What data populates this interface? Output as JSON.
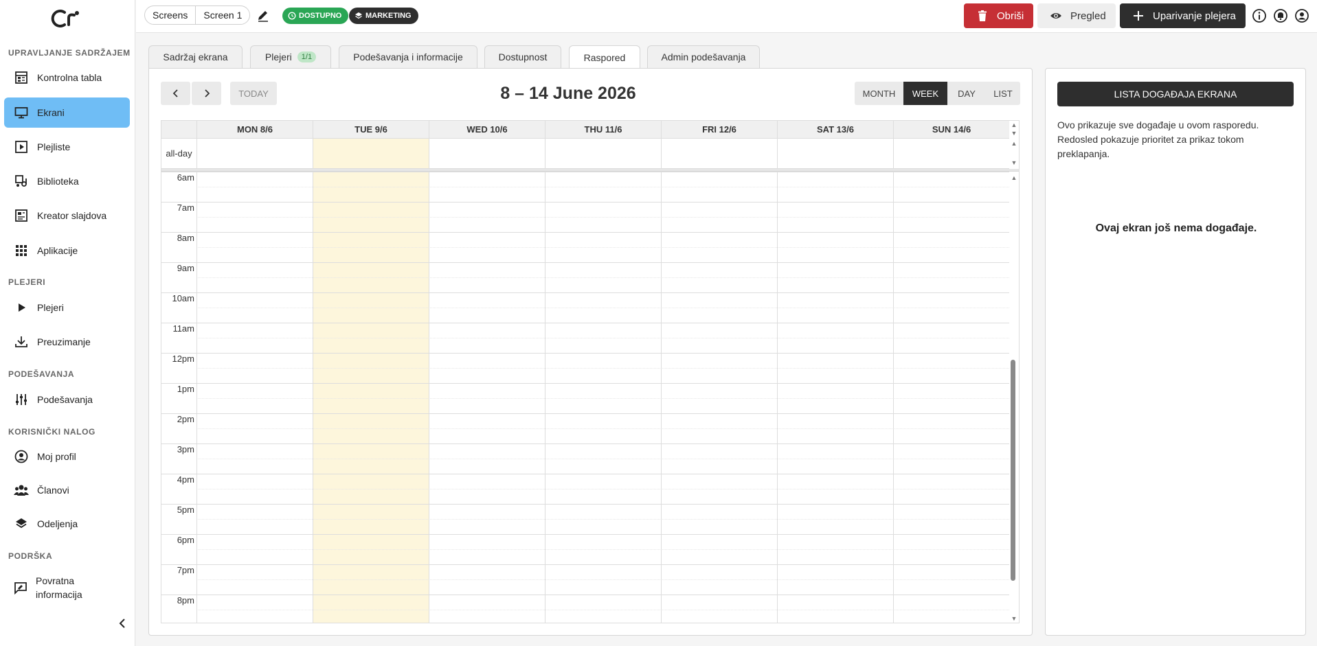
{
  "sidebar": {
    "sections": [
      {
        "title": "UPRAVLJANJE SADRŽAJEM"
      },
      {
        "title": "PLEJERI"
      },
      {
        "title": "PODEŠAVANJA"
      },
      {
        "title": "KORISNIČKI NALOG"
      },
      {
        "title": "PODRŠKA"
      }
    ],
    "items": [
      {
        "label": "Kontrolna tabla",
        "icon": "dashboard-icon"
      },
      {
        "label": "Ekrani",
        "icon": "monitor-icon",
        "active": true
      },
      {
        "label": "Plejliste",
        "icon": "playlist-icon"
      },
      {
        "label": "Biblioteka",
        "icon": "library-icon"
      },
      {
        "label": "Kreator slajdova",
        "icon": "slide-creator-icon"
      },
      {
        "label": "Aplikacije",
        "icon": "apps-grid-icon"
      },
      {
        "label": "Plejeri",
        "icon": "play-icon"
      },
      {
        "label": "Preuzimanje",
        "icon": "download-icon"
      },
      {
        "label": "Podešavanja",
        "icon": "sliders-icon"
      },
      {
        "label": "Moj profil",
        "icon": "profile-icon"
      },
      {
        "label": "Članovi",
        "icon": "members-icon"
      },
      {
        "label": "Odeljenja",
        "icon": "layers-icon"
      },
      {
        "label": "Povratna informacija",
        "icon": "feedback-icon"
      }
    ]
  },
  "topbar": {
    "breadcrumb": [
      "Screens",
      "Screen 1"
    ],
    "status_badge": "DOSTUPNO",
    "group_badge": "MARKETING",
    "delete_label": "Obriši",
    "preview_label": "Pregled",
    "pair_label": "Uparivanje plejera"
  },
  "tabs": [
    {
      "label": "Sadržaj ekrana"
    },
    {
      "label": "Plejeri",
      "count": "1/1"
    },
    {
      "label": "Podešavanja i informacije"
    },
    {
      "label": "Dostupnost"
    },
    {
      "label": "Raspored",
      "active": true
    },
    {
      "label": "Admin podešavanja"
    }
  ],
  "calendar": {
    "today_label": "TODAY",
    "title": "8 – 14 June 2026",
    "views": [
      "MONTH",
      "WEEK",
      "DAY",
      "LIST"
    ],
    "active_view": "WEEK",
    "days": [
      "MON 8/6",
      "TUE 9/6",
      "WED 10/6",
      "THU 11/6",
      "FRI 12/6",
      "SAT 13/6",
      "SUN 14/6"
    ],
    "today_index": 1,
    "allday_label": "all-day",
    "hours": [
      "6am",
      "7am",
      "8am",
      "9am",
      "10am",
      "11am",
      "12pm",
      "1pm",
      "2pm",
      "3pm",
      "4pm",
      "5pm",
      "6pm",
      "7pm",
      "8pm"
    ]
  },
  "side": {
    "list_button": "LISTA DOGAĐAJA EKRANA",
    "description": "Ovo prikazuje sve događaje u ovom rasporedu. Redosled pokazuje prioritet za prikaz tokom preklapanja.",
    "empty_message": "Ovaj ekran još nema događaje."
  },
  "colors": {
    "accent": "#6fbdf5",
    "status_green": "#2aa655",
    "delete_red": "#c62f35",
    "dark": "#2e2e2e",
    "today_bg": "#fdf6dc"
  }
}
